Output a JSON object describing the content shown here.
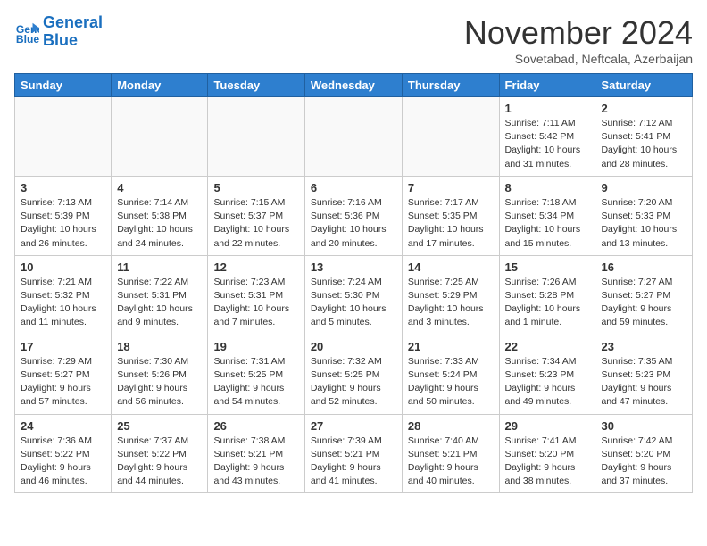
{
  "header": {
    "logo_line1": "General",
    "logo_line2": "Blue",
    "month": "November 2024",
    "location": "Sovetabad, Neftcala, Azerbaijan"
  },
  "weekdays": [
    "Sunday",
    "Monday",
    "Tuesday",
    "Wednesday",
    "Thursday",
    "Friday",
    "Saturday"
  ],
  "weeks": [
    [
      {
        "day": "",
        "info": ""
      },
      {
        "day": "",
        "info": ""
      },
      {
        "day": "",
        "info": ""
      },
      {
        "day": "",
        "info": ""
      },
      {
        "day": "",
        "info": ""
      },
      {
        "day": "1",
        "info": "Sunrise: 7:11 AM\nSunset: 5:42 PM\nDaylight: 10 hours and 31 minutes."
      },
      {
        "day": "2",
        "info": "Sunrise: 7:12 AM\nSunset: 5:41 PM\nDaylight: 10 hours and 28 minutes."
      }
    ],
    [
      {
        "day": "3",
        "info": "Sunrise: 7:13 AM\nSunset: 5:39 PM\nDaylight: 10 hours and 26 minutes."
      },
      {
        "day": "4",
        "info": "Sunrise: 7:14 AM\nSunset: 5:38 PM\nDaylight: 10 hours and 24 minutes."
      },
      {
        "day": "5",
        "info": "Sunrise: 7:15 AM\nSunset: 5:37 PM\nDaylight: 10 hours and 22 minutes."
      },
      {
        "day": "6",
        "info": "Sunrise: 7:16 AM\nSunset: 5:36 PM\nDaylight: 10 hours and 20 minutes."
      },
      {
        "day": "7",
        "info": "Sunrise: 7:17 AM\nSunset: 5:35 PM\nDaylight: 10 hours and 17 minutes."
      },
      {
        "day": "8",
        "info": "Sunrise: 7:18 AM\nSunset: 5:34 PM\nDaylight: 10 hours and 15 minutes."
      },
      {
        "day": "9",
        "info": "Sunrise: 7:20 AM\nSunset: 5:33 PM\nDaylight: 10 hours and 13 minutes."
      }
    ],
    [
      {
        "day": "10",
        "info": "Sunrise: 7:21 AM\nSunset: 5:32 PM\nDaylight: 10 hours and 11 minutes."
      },
      {
        "day": "11",
        "info": "Sunrise: 7:22 AM\nSunset: 5:31 PM\nDaylight: 10 hours and 9 minutes."
      },
      {
        "day": "12",
        "info": "Sunrise: 7:23 AM\nSunset: 5:31 PM\nDaylight: 10 hours and 7 minutes."
      },
      {
        "day": "13",
        "info": "Sunrise: 7:24 AM\nSunset: 5:30 PM\nDaylight: 10 hours and 5 minutes."
      },
      {
        "day": "14",
        "info": "Sunrise: 7:25 AM\nSunset: 5:29 PM\nDaylight: 10 hours and 3 minutes."
      },
      {
        "day": "15",
        "info": "Sunrise: 7:26 AM\nSunset: 5:28 PM\nDaylight: 10 hours and 1 minute."
      },
      {
        "day": "16",
        "info": "Sunrise: 7:27 AM\nSunset: 5:27 PM\nDaylight: 9 hours and 59 minutes."
      }
    ],
    [
      {
        "day": "17",
        "info": "Sunrise: 7:29 AM\nSunset: 5:27 PM\nDaylight: 9 hours and 57 minutes."
      },
      {
        "day": "18",
        "info": "Sunrise: 7:30 AM\nSunset: 5:26 PM\nDaylight: 9 hours and 56 minutes."
      },
      {
        "day": "19",
        "info": "Sunrise: 7:31 AM\nSunset: 5:25 PM\nDaylight: 9 hours and 54 minutes."
      },
      {
        "day": "20",
        "info": "Sunrise: 7:32 AM\nSunset: 5:25 PM\nDaylight: 9 hours and 52 minutes."
      },
      {
        "day": "21",
        "info": "Sunrise: 7:33 AM\nSunset: 5:24 PM\nDaylight: 9 hours and 50 minutes."
      },
      {
        "day": "22",
        "info": "Sunrise: 7:34 AM\nSunset: 5:23 PM\nDaylight: 9 hours and 49 minutes."
      },
      {
        "day": "23",
        "info": "Sunrise: 7:35 AM\nSunset: 5:23 PM\nDaylight: 9 hours and 47 minutes."
      }
    ],
    [
      {
        "day": "24",
        "info": "Sunrise: 7:36 AM\nSunset: 5:22 PM\nDaylight: 9 hours and 46 minutes."
      },
      {
        "day": "25",
        "info": "Sunrise: 7:37 AM\nSunset: 5:22 PM\nDaylight: 9 hours and 44 minutes."
      },
      {
        "day": "26",
        "info": "Sunrise: 7:38 AM\nSunset: 5:21 PM\nDaylight: 9 hours and 43 minutes."
      },
      {
        "day": "27",
        "info": "Sunrise: 7:39 AM\nSunset: 5:21 PM\nDaylight: 9 hours and 41 minutes."
      },
      {
        "day": "28",
        "info": "Sunrise: 7:40 AM\nSunset: 5:21 PM\nDaylight: 9 hours and 40 minutes."
      },
      {
        "day": "29",
        "info": "Sunrise: 7:41 AM\nSunset: 5:20 PM\nDaylight: 9 hours and 38 minutes."
      },
      {
        "day": "30",
        "info": "Sunrise: 7:42 AM\nSunset: 5:20 PM\nDaylight: 9 hours and 37 minutes."
      }
    ]
  ]
}
